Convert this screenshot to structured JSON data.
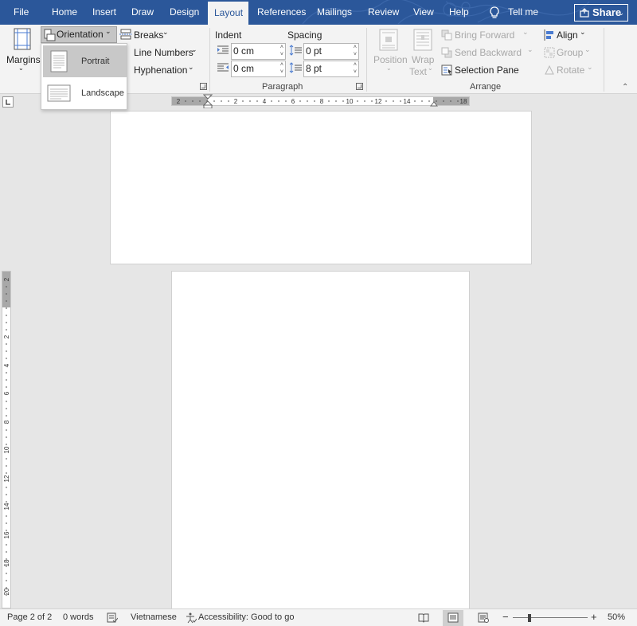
{
  "tabs": [
    {
      "label": "File"
    },
    {
      "label": "Home"
    },
    {
      "label": "Insert"
    },
    {
      "label": "Draw"
    },
    {
      "label": "Design"
    },
    {
      "label": "Layout"
    },
    {
      "label": "References"
    },
    {
      "label": "Mailings"
    },
    {
      "label": "Review"
    },
    {
      "label": "View"
    },
    {
      "label": "Help"
    }
  ],
  "tell_me": "Tell me",
  "share": "Share",
  "page_setup": {
    "margins": "Margins",
    "orientation": "Orientation",
    "breaks": "Breaks",
    "line_numbers": "Line Numbers",
    "hyphenation": "Hyphenation"
  },
  "orientation_menu": {
    "portrait": "Portrait",
    "landscape": "Landscape",
    "selected": "Portrait"
  },
  "paragraph": {
    "indent_label": "Indent",
    "spacing_label": "Spacing",
    "indent_left": "0 cm",
    "indent_right": "0 cm",
    "spacing_before": "0 pt",
    "spacing_after": "8 pt",
    "group_label": "Paragraph"
  },
  "arrange": {
    "position": "Position",
    "wrap_text_1": "Wrap",
    "wrap_text_2": "Text",
    "bring_forward": "Bring Forward",
    "send_backward": "Send Backward",
    "selection_pane": "Selection Pane",
    "align": "Align",
    "group": "Group",
    "rotate": "Rotate",
    "group_label": "Arrange"
  },
  "hruler_labels": [
    "2",
    "2",
    "4",
    "6",
    "8",
    "10",
    "12",
    "14",
    "18"
  ],
  "vruler_labels": [
    "2",
    "2",
    "4",
    "6",
    "8",
    "10",
    "12",
    "14",
    "16",
    "18",
    "20"
  ],
  "status": {
    "page": "Page 2 of 2",
    "words": "0 words",
    "language": "Vietnamese",
    "accessibility": "Accessibility: Good to go",
    "zoom": "50%",
    "zoom_level": 0.5
  },
  "colors": {
    "ribbon_blue": "#2b579a",
    "ribbon_bg": "#f3f3f3",
    "workspace": "#e6e6e6"
  }
}
